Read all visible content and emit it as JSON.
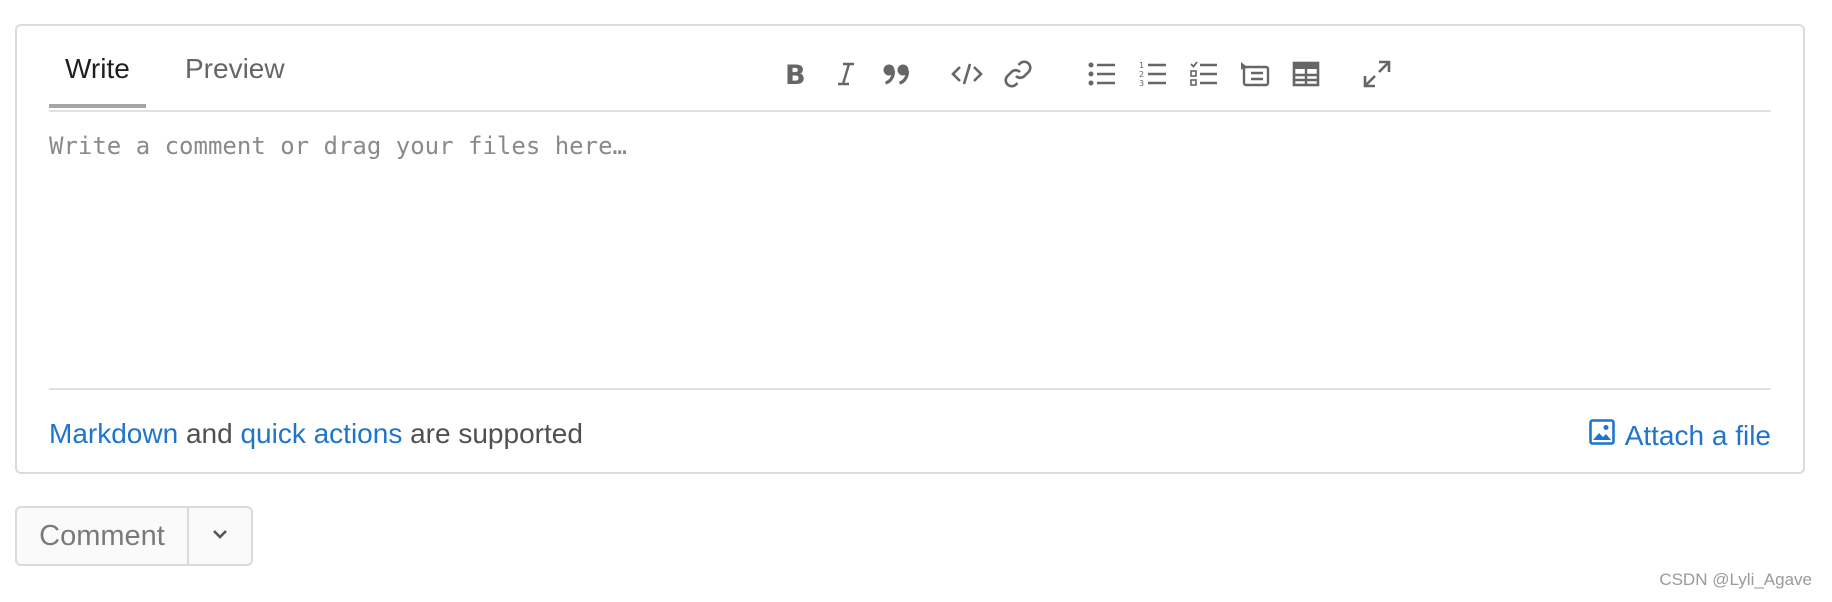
{
  "tabs": [
    {
      "label": "Write",
      "active": true
    },
    {
      "label": "Preview",
      "active": false
    }
  ],
  "toolbar": {
    "buttons": [
      {
        "name": "bold-icon"
      },
      {
        "name": "italic-icon"
      },
      {
        "name": "quote-icon"
      },
      {
        "name": "code-icon"
      },
      {
        "name": "link-icon"
      },
      {
        "name": "bullet-list-icon"
      },
      {
        "name": "numbered-list-icon"
      },
      {
        "name": "task-list-icon"
      },
      {
        "name": "collapsible-section-icon"
      },
      {
        "name": "table-icon"
      },
      {
        "name": "fullscreen-icon"
      }
    ]
  },
  "editor": {
    "placeholder": "Write a comment or drag your files here…",
    "value": ""
  },
  "footer": {
    "markdown_link": "Markdown",
    "and_text": "and",
    "quick_actions_link": "quick actions",
    "supported_text": "are supported",
    "attach_label": "Attach a file"
  },
  "actions": {
    "comment_label": "Comment"
  },
  "watermark": "CSDN @Lyli_Agave",
  "colors": {
    "link": "#1f75cb",
    "border": "#dbdbdb",
    "muted": "#666666"
  }
}
